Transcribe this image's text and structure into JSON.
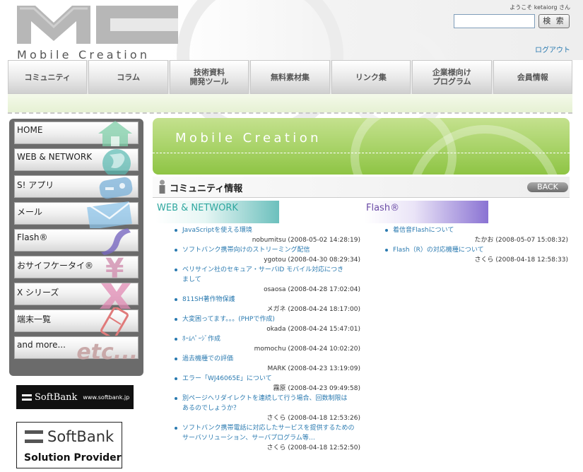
{
  "header": {
    "logo_text": "Mobile Creation",
    "welcome": "ようこそ ketaiorg さん",
    "search_placeholder": "",
    "search_button": "検 索",
    "logout": "ログアウト"
  },
  "nav": [
    {
      "label": "コミュニティ"
    },
    {
      "label": "コラム"
    },
    {
      "label": "技術資料\n開発ツール"
    },
    {
      "label": "無料素材集"
    },
    {
      "label": "リンク集"
    },
    {
      "label": "企業様向け\nプログラム"
    },
    {
      "label": "会員情報"
    }
  ],
  "sidebar": {
    "items": [
      {
        "label": "HOME",
        "icon": "home-icon"
      },
      {
        "label": "WEB & NETWORK",
        "icon": "globe-icon"
      },
      {
        "label": "S! アプリ",
        "icon": "gamepad-icon"
      },
      {
        "label": "メール",
        "icon": "envelope-icon"
      },
      {
        "label": "Flash®",
        "icon": "flash-icon"
      },
      {
        "label": "おサイフケータイ®",
        "icon": "yen-icon"
      },
      {
        "label": "X シリーズ",
        "icon": "x-icon"
      },
      {
        "label": "端末一覧",
        "icon": "phone-icon"
      },
      {
        "label": "and more...",
        "icon": "etc-icon",
        "deco_text": "etc..."
      }
    ],
    "banner_softbank": {
      "brand": "SoftBank",
      "url": "www.softbank.jp"
    },
    "banner_solution": {
      "brand": "SoftBank",
      "sub": "Solution Provider"
    }
  },
  "hero": {
    "title": "Mobile Creation"
  },
  "section": {
    "title": "コミュニティ情報",
    "back": "BACK"
  },
  "columns": {
    "web": {
      "heading": "WEB & NETWORK",
      "posts": [
        {
          "title": "JavaScriptを使える環境",
          "meta": "nobumitsu (2008-05-02 14:28:19)"
        },
        {
          "title": "ソフトバンク携帯向けのストリーミング配信",
          "meta": "ygotou (2008-04-30 08:29:34)"
        },
        {
          "title": "ベリサイン社のセキュア・サーバID  モバイル対応につきまして",
          "meta": "osaosa (2008-04-28 17:02:04)"
        },
        {
          "title": "811SH著作物保護",
          "meta": "メガネ (2008-04-24 18:17:00)"
        },
        {
          "title": "大変困ってます。。。(PHPで作成)",
          "meta": "okada (2008-04-24 15:47:01)"
        },
        {
          "title": "ﾎｰﾑﾍﾟｰｼﾞ作成",
          "meta": "momochu (2008-04-24 10:02:20)"
        },
        {
          "title": "過去機種での評価",
          "meta": "MARK (2008-04-23 13:19:09)"
        },
        {
          "title": "エラー「WJ46065E」について",
          "meta": "霧原 (2008-04-23 09:49:58)"
        },
        {
          "title": "別ページへリダイレクトを連続して行う場合、回数制限はあるのでしょうか？",
          "meta": "さくら (2008-04-18 12:53:26)"
        },
        {
          "title": "ソフトバンク携帯電話に対応したサービスを提供するためのサーバソリューション、サーバプログラム等…",
          "meta": "さくら (2008-04-18 12:52:50)"
        }
      ]
    },
    "flash": {
      "heading": "Flash®",
      "posts": [
        {
          "title": "着信音Flashについて",
          "meta": "たかお (2008-05-07 15:08:32)"
        },
        {
          "title": "Flash（R）の対応機種について",
          "meta": "さくら (2008-04-18 12:58:33)"
        }
      ]
    }
  },
  "colors": {
    "accent_green": "#a7d266",
    "link_blue": "#2a7ab0",
    "web_teal": "#2ea79f",
    "flash_purple": "#6a4aa5"
  }
}
